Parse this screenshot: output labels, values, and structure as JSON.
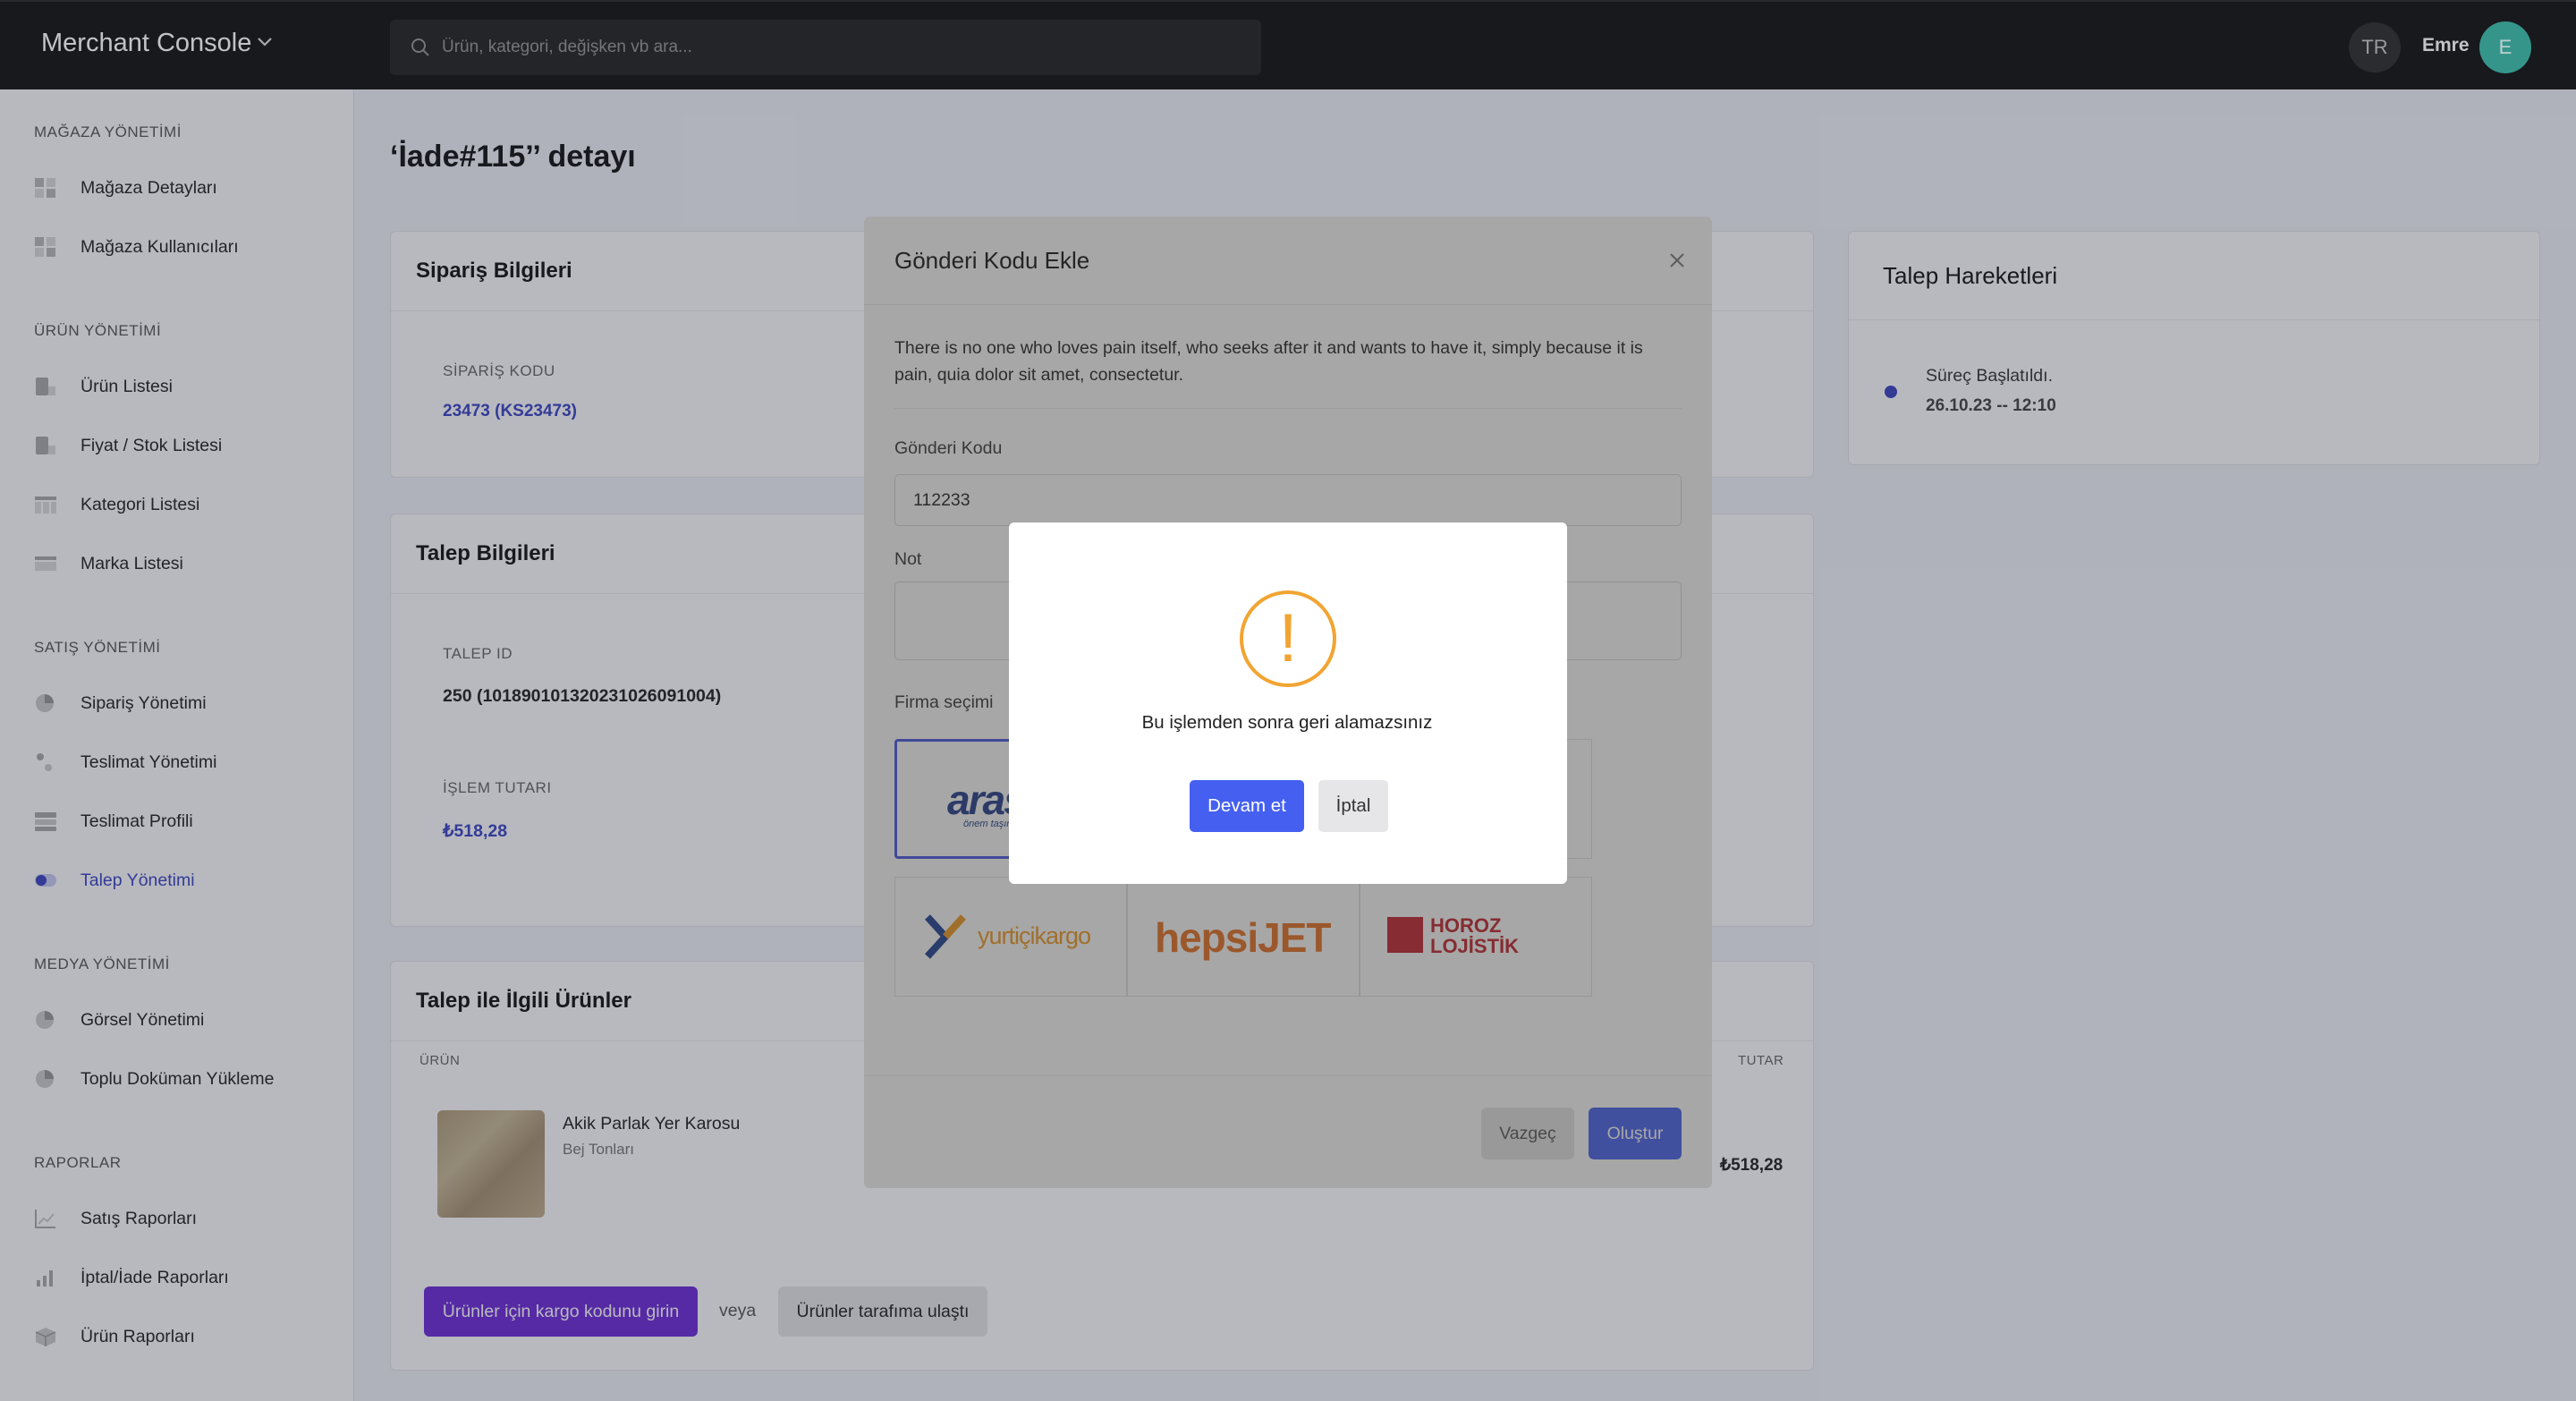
{
  "topbar": {
    "brand": "Merchant Console",
    "search_placeholder": "Ürün, kategori, değişken vb ara...",
    "language": "TR",
    "user_name": "Emre",
    "avatar_initial": "E"
  },
  "sidebar": {
    "sections": [
      {
        "title": "MAĞAZA YÖNETİMİ",
        "items": [
          {
            "label": "Mağaza Detayları",
            "icon": "grid-icon"
          },
          {
            "label": "Mağaza Kullanıcıları",
            "icon": "grid-icon"
          }
        ]
      },
      {
        "title": "ÜRÜN YÖNETİMİ",
        "items": [
          {
            "label": "Ürün Listesi",
            "icon": "product-icon"
          },
          {
            "label": "Fiyat / Stok Listesi",
            "icon": "price-icon"
          },
          {
            "label": "Kategori Listesi",
            "icon": "table-icon"
          },
          {
            "label": "Marka Listesi",
            "icon": "brand-icon"
          }
        ]
      },
      {
        "title": "SATIŞ YÖNETİMİ",
        "items": [
          {
            "label": "Sipariş Yönetimi",
            "icon": "order-icon"
          },
          {
            "label": "Teslimat Yönetimi",
            "icon": "delivery-icon"
          },
          {
            "label": "Teslimat Profili",
            "icon": "profile-icon"
          },
          {
            "label": "Talep Yönetimi",
            "icon": "toggle-icon",
            "active": true
          }
        ]
      },
      {
        "title": "MEDYA YÖNETİMİ",
        "items": [
          {
            "label": "Görsel Yönetimi",
            "icon": "image-icon"
          },
          {
            "label": "Toplu Doküman Yükleme",
            "icon": "upload-icon"
          }
        ]
      },
      {
        "title": "RAPORLAR",
        "items": [
          {
            "label": "Satış Raporları",
            "icon": "line-chart-icon"
          },
          {
            "label": "İptal/İade Raporları",
            "icon": "bar-chart-icon"
          },
          {
            "label": "Ürün Raporları",
            "icon": "box-icon"
          }
        ]
      }
    ]
  },
  "main": {
    "title": "‘İade#115’’ detayı",
    "order_card": {
      "title": "Sipariş Bilgileri",
      "code_label": "SİPARİŞ KODU",
      "code_value": "23473 (KS23473)"
    },
    "request_card": {
      "title": "Talep Bilgileri",
      "id_label": "TALEP ID",
      "id_value": "250 (10189010132023102609100​4)",
      "amount_label": "İŞLEM TUTARI",
      "amount_value": "₺518,28"
    },
    "products_card": {
      "title": "Talep ile İlgili Ürünler",
      "col_product": "ÜRÜN",
      "col_amount": "TUTAR",
      "product_name": "Akik Parlak Yer Karosu",
      "product_variant": "Bej Tonları",
      "product_amount": "₺518,28",
      "cargo_button": "Ürünler için kargo kodunu girin",
      "or_text": "veya",
      "received_button": "Ürünler tarafıma ulaştı"
    },
    "history_card": {
      "title": "Talep Hareketleri",
      "event_label": "Süreç Başlatıldı.",
      "event_time": "26.10.23 -- 12:10"
    }
  },
  "modal": {
    "title": "Gönderi Kodu Ekle",
    "description": "There is no one who loves pain itself, who seeks after it and wants to have it, simply because it is pain, quia dolor sit amet, consectetur.",
    "code_label": "Gönderi Kodu",
    "code_value": "112233",
    "note_label": "Not",
    "company_label": "Firma seçimi",
    "carriers": [
      {
        "name": "aras",
        "tagline": "önem taşır...",
        "selected": true
      },
      {
        "name": "yurtiçikargo"
      },
      {
        "name": "hepsiJET"
      },
      {
        "name": "HOROZ LOJİSTİK"
      }
    ],
    "cancel_button": "Vazgeç",
    "create_button": "Oluştur"
  },
  "alert": {
    "icon": "!",
    "message": "Bu işlemden sonra geri alamazsınız",
    "confirm_button": "Devam et",
    "cancel_button": "İptal"
  },
  "colors": {
    "primary": "#4560f0",
    "purple": "#6d2bd9",
    "warning": "#f2a432",
    "link": "#3a43c4"
  }
}
